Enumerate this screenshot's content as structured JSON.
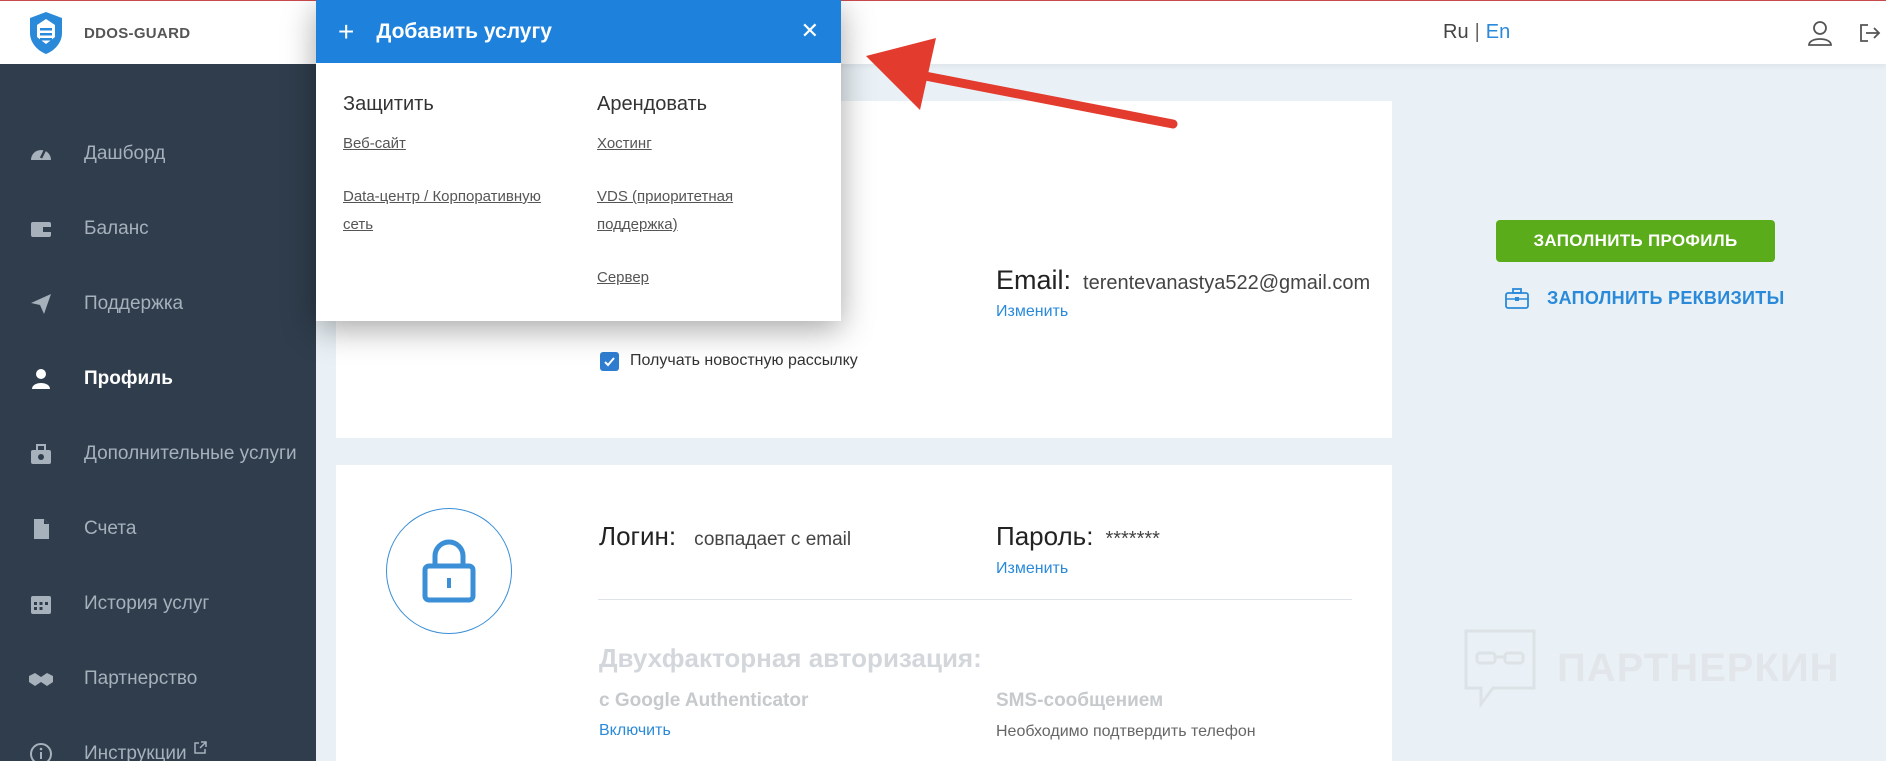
{
  "header": {
    "brand": "DDOS-GUARD",
    "lang_ru": "Ru",
    "lang_sep": "|",
    "lang_en": "En",
    "accent_color": "#2a8ad9"
  },
  "sidebar": {
    "items": [
      {
        "label": "Дашборд",
        "icon": "dashboard-icon"
      },
      {
        "label": "Баланс",
        "icon": "wallet-icon"
      },
      {
        "label": "Поддержка",
        "icon": "paper-plane-icon"
      },
      {
        "label": "Профиль",
        "icon": "user-icon",
        "active": true
      },
      {
        "label": "Дополнительные услуги",
        "icon": "services-icon"
      },
      {
        "label": "Счета",
        "icon": "document-icon"
      },
      {
        "label": "История услуг",
        "icon": "calendar-icon"
      },
      {
        "label": "Партнерство",
        "icon": "handshake-icon"
      },
      {
        "label": "Инструкции",
        "icon": "info-icon"
      }
    ]
  },
  "profile": {
    "email_label": "Email:",
    "email_value": "terentevanastya522@gmail.com",
    "email_change": "Изменить",
    "newsletter_label": "Получать новостную рассылку",
    "newsletter_checked": true,
    "fill_profile_button": "ЗАПОЛНИТЬ ПРОФИЛЬ",
    "fill_requisites_link": "ЗАПОЛНИТЬ РЕКВИЗИТЫ"
  },
  "security": {
    "login_label": "Логин:",
    "login_value": "совпадает с email",
    "password_label": "Пароль:",
    "password_value": "*******",
    "password_change": "Изменить",
    "twofa_title": "Двухфакторная авторизация:",
    "google_label": "с Google Authenticator",
    "google_action": "Включить",
    "sms_label": "SMS-сообщением",
    "sms_note": "Необходимо подтвердить телефон"
  },
  "watermark": "ПАРТНЕРКИН",
  "popup": {
    "title": "Добавить услугу",
    "plus": "+",
    "close": "✕",
    "protect_heading": "Защитить",
    "protect_links": [
      "Веб-сайт",
      "Data-центр / Корпоративную сеть"
    ],
    "rent_heading": "Арендовать",
    "rent_links": [
      "Хостинг",
      "VDS (приоритетная поддержка)",
      "Сервер"
    ]
  }
}
